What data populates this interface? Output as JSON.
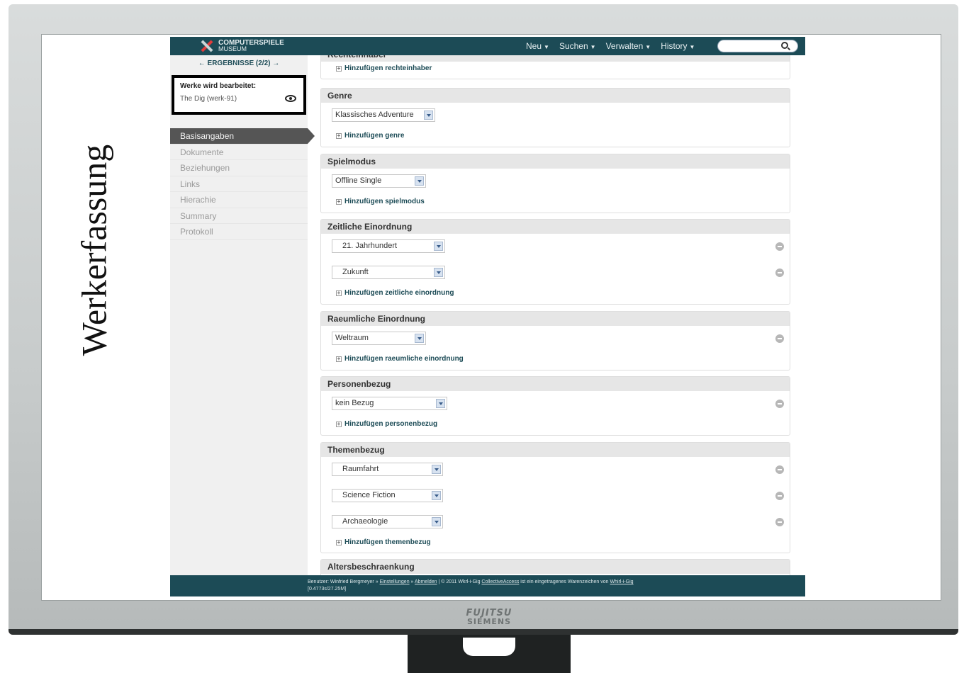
{
  "side_label": "Werkerfassung",
  "monitor": {
    "brand_top": "FUJITSU",
    "brand_bottom": "SIEMENS"
  },
  "header": {
    "logo_line1": "COMPUTERSPIELE",
    "logo_line2": "MUSEUM",
    "nav": [
      {
        "label": "Neu"
      },
      {
        "label": "Suchen"
      },
      {
        "label": "Verwalten"
      },
      {
        "label": "History"
      }
    ],
    "search_value": ""
  },
  "sidebar": {
    "results_link": "← ERGEBNISSE (2/2) →",
    "editing_title": "Werke wird bearbeitet:",
    "editing_value": "The Dig (werk-91)",
    "items": [
      {
        "label": "Basisangaben",
        "active": true
      },
      {
        "label": "Dokumente"
      },
      {
        "label": "Beziehungen"
      },
      {
        "label": "Links"
      },
      {
        "label": "Hierachie"
      },
      {
        "label": "Summary"
      },
      {
        "label": "Protokoll"
      }
    ]
  },
  "panels": {
    "rechteinhaber": {
      "title": "Rechteinhaber",
      "add": "Hinzufügen rechteinhaber"
    },
    "genre": {
      "title": "Genre",
      "fields": [
        "Klassisches Adventure"
      ],
      "add": "Hinzufügen genre"
    },
    "spielmodus": {
      "title": "Spielmodus",
      "fields": [
        "Offline Single"
      ],
      "add": "Hinzufügen spielmodus"
    },
    "zeitliche": {
      "title": "Zeitliche Einordnung",
      "fields": [
        "21. Jahrhundert",
        "Zukunft"
      ],
      "add": "Hinzufügen zeitliche einordnung"
    },
    "raeumliche": {
      "title": "Raeumliche Einordnung",
      "fields": [
        "Weltraum"
      ],
      "add": "Hinzufügen raeumliche einordnung"
    },
    "personen": {
      "title": "Personenbezug",
      "fields": [
        "kein Bezug"
      ],
      "add": "Hinzufügen personenbezug"
    },
    "themen": {
      "title": "Themenbezug",
      "fields": [
        "Raumfahrt",
        "Science Fiction",
        "Archaeologie"
      ],
      "add": "Hinzufügen themenbezug"
    },
    "alters": {
      "title": "Altersbeschraenkung"
    }
  },
  "footer": {
    "user_prefix": "Benutzer: Winfried Bergmeyer »",
    "settings_link": "Einstellungen",
    "sep1": "»",
    "logout_link": "Abmelden",
    "copyright": "| © 2011 Wkrl-i-Gig",
    "ca_link": "CollectiveAccess",
    "trademark": "ist ein eingetragenes Warenzeichen von",
    "owner_link": "Whirl-i-Gig",
    "timing": "[0.4773s/27.25M]"
  },
  "colors": {
    "header": "#1c4b56",
    "active_nav": "#555555",
    "panel_header": "#e6e6e6"
  }
}
